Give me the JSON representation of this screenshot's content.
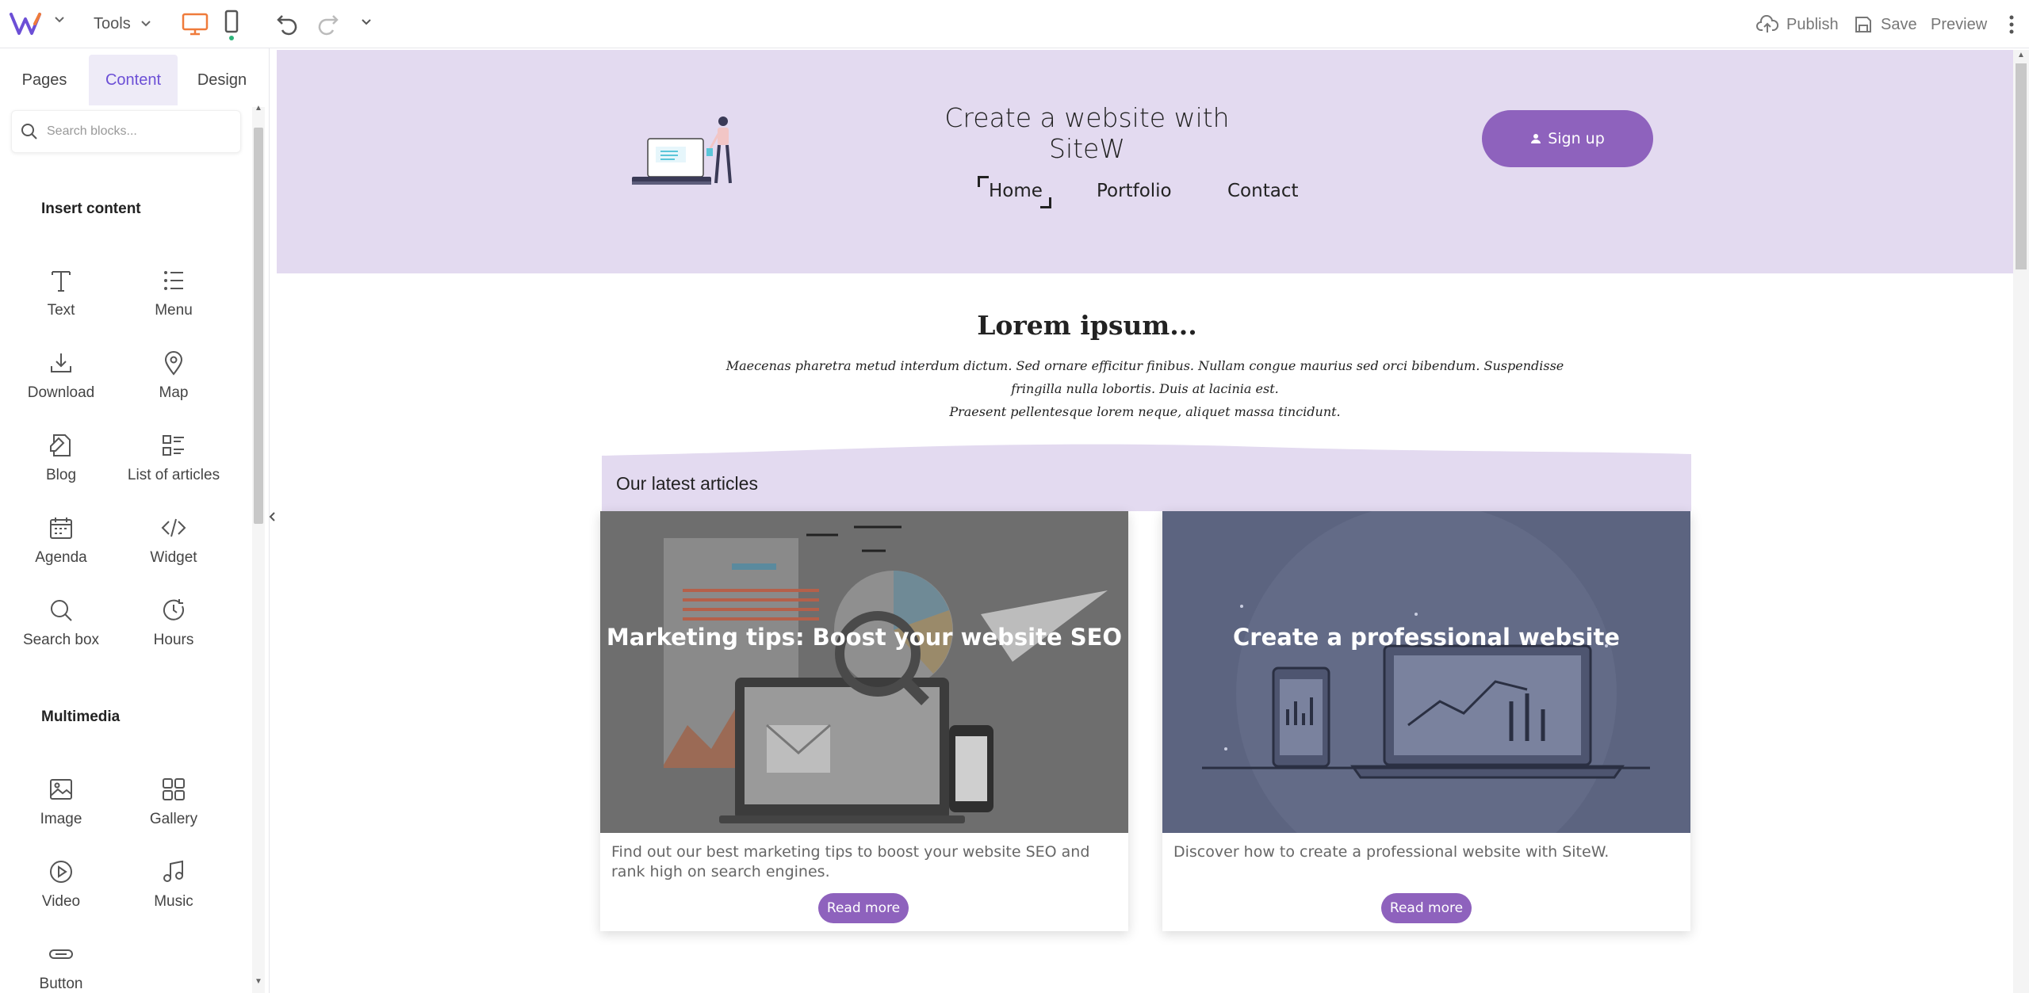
{
  "toolbar": {
    "tools_label": "Tools",
    "publish_label": "Publish",
    "save_label": "Save",
    "preview_label": "Preview",
    "accent_color": "#ef7b3b",
    "brand_color": "#6c4fd6"
  },
  "panel": {
    "tabs": [
      "Pages",
      "Content",
      "Design"
    ],
    "active_tab": "Content",
    "search_placeholder": "Search blocks...",
    "sections": [
      {
        "title": "Insert content",
        "blocks": [
          {
            "label": "Text",
            "icon": "text-icon"
          },
          {
            "label": "Menu",
            "icon": "menu-list-icon"
          },
          {
            "label": "Download",
            "icon": "download-icon"
          },
          {
            "label": "Map",
            "icon": "map-pin-icon"
          },
          {
            "label": "Blog",
            "icon": "blog-icon"
          },
          {
            "label": "List of articles",
            "icon": "list-of-articles-icon"
          },
          {
            "label": "Agenda",
            "icon": "calendar-icon"
          },
          {
            "label": "Widget",
            "icon": "code-icon"
          },
          {
            "label": "Search box",
            "icon": "search-icon"
          },
          {
            "label": "Hours",
            "icon": "clock-icon"
          }
        ]
      },
      {
        "title": "Multimedia",
        "blocks": [
          {
            "label": "Image",
            "icon": "image-icon"
          },
          {
            "label": "Gallery",
            "icon": "gallery-grid-icon"
          },
          {
            "label": "Video",
            "icon": "play-icon"
          },
          {
            "label": "Music",
            "icon": "music-icon"
          },
          {
            "label": "Button",
            "icon": "button-icon"
          }
        ]
      }
    ]
  },
  "site": {
    "title": "Create a website with SiteW",
    "nav": [
      "Home",
      "Portfolio",
      "Contact"
    ],
    "active_nav": "Home",
    "signup_label": "Sign up",
    "hero_color": "#e3daf0",
    "button_color": "#8e62bd",
    "lorem_title": "Lorem ipsum...",
    "lorem_text_line1": "Maecenas pharetra metud interdum dictum. Sed ornare efficitur finibus. Nullam congue maurius sed orci bibendum. Suspendisse fringilla nulla lobortis. Duis at lacinia est.",
    "lorem_text_line2": "Praesent pellentesque lorem neque, aliquet massa tincidunt.",
    "latest_title": "Our latest articles",
    "articles": [
      {
        "title": "Marketing tips: Boost your website SEO",
        "description": "Find out our best marketing tips to boost your website SEO and rank high on search engines.",
        "read_more": "Read more"
      },
      {
        "title": "Create a professional website",
        "description": "Discover how to create a professional website with SiteW.",
        "read_more": "Read more"
      }
    ]
  }
}
